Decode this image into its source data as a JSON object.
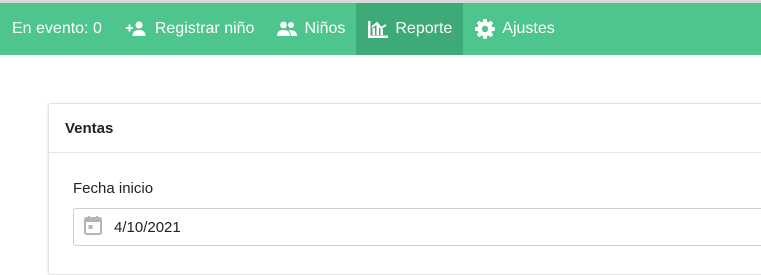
{
  "nav": {
    "count_label": "En evento: 0",
    "items": [
      {
        "label": "Registrar niño",
        "icon": "user-plus-icon",
        "active": false
      },
      {
        "label": "Niños",
        "icon": "users-icon",
        "active": false
      },
      {
        "label": "Reporte",
        "icon": "chart-icon",
        "active": true
      },
      {
        "label": "Ajustes",
        "icon": "gear-icon",
        "active": false
      }
    ]
  },
  "card": {
    "title": "Ventas",
    "start_date_label": "Fecha inicio",
    "start_date_value": "4/10/2021"
  },
  "colors": {
    "navbar": "#4dc58c",
    "navbar_active": "#3eaa77",
    "text": "#222222"
  }
}
